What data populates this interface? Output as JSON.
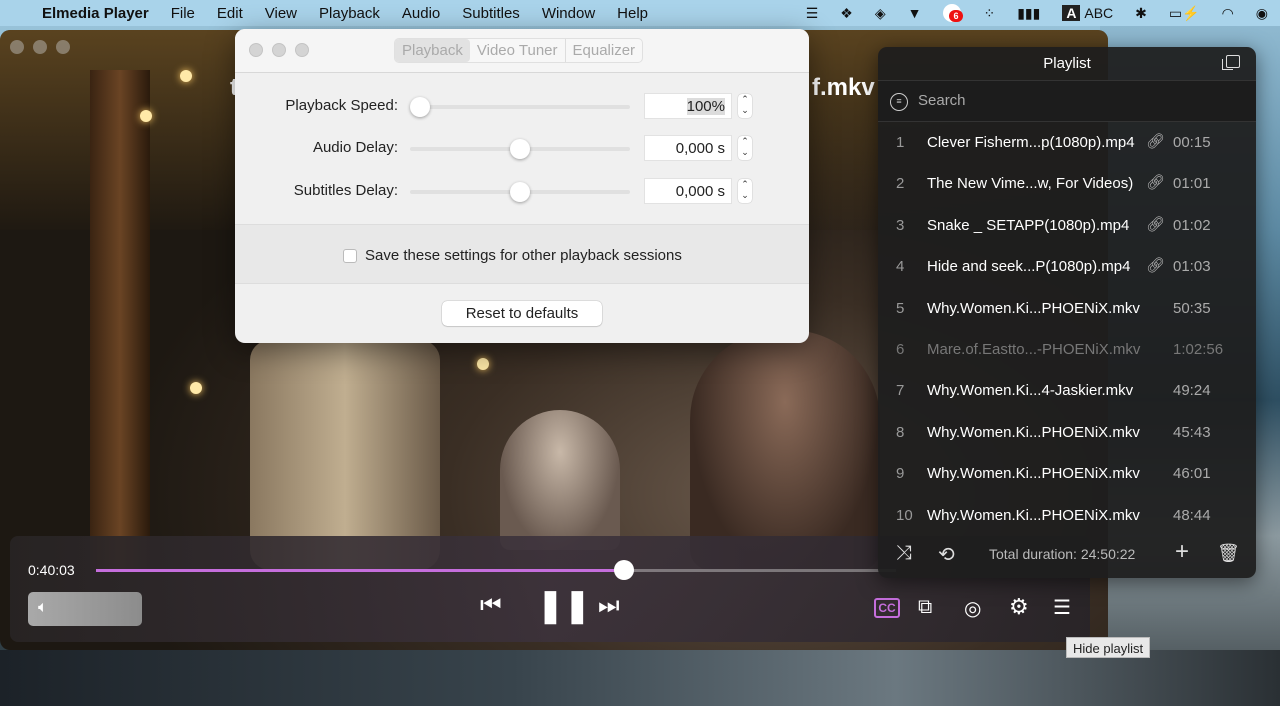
{
  "menubar": {
    "app": "Elmedia Player",
    "items": [
      "File",
      "Edit",
      "View",
      "Playback",
      "Audio",
      "Subtitles",
      "Window",
      "Help"
    ],
    "notification_count": "6",
    "input_source": "ABC"
  },
  "player": {
    "title_fragment_left": "t",
    "title_fragment_right": "f.mkv",
    "elapsed": "0:40:03",
    "progress": 0.66
  },
  "dialog": {
    "tabs": [
      "Playback",
      "Video Tuner",
      "Equalizer"
    ],
    "active_tab": "Playback",
    "rows": [
      {
        "label": "Playback Speed:",
        "value": "100%",
        "slider": 0.0
      },
      {
        "label": "Audio Delay:",
        "value": "0,000 s",
        "slider": 0.5
      },
      {
        "label": "Subtitles Delay:",
        "value": "0,000 s",
        "slider": 0.5
      }
    ],
    "save_label": "Save these settings for other playback sessions",
    "save_checked": false,
    "reset_label": "Reset to defaults"
  },
  "playlist": {
    "title": "Playlist",
    "search_placeholder": "Search",
    "items": [
      {
        "n": "1",
        "title": "Clever Fisherm...p(1080p).mp4",
        "link": true,
        "duration": "00:15"
      },
      {
        "n": "2",
        "title": "The New Vime...w, For Videos)",
        "link": true,
        "duration": "01:01"
      },
      {
        "n": "3",
        "title": "Snake _ SETAPP(1080p).mp4",
        "link": true,
        "duration": "01:02"
      },
      {
        "n": "4",
        "title": "Hide and seek...P(1080p).mp4",
        "link": true,
        "duration": "01:03"
      },
      {
        "n": "5",
        "title": "Why.Women.Ki...PHOENiX.mkv",
        "link": false,
        "duration": "50:35"
      },
      {
        "n": "6",
        "title": "Mare.of.Eastto...-PHOENiX.mkv",
        "link": false,
        "duration": "1:02:56",
        "dimmed": true
      },
      {
        "n": "7",
        "title": "Why.Women.Ki...4-Jaskier.mkv",
        "link": false,
        "duration": "49:24"
      },
      {
        "n": "8",
        "title": "Why.Women.Ki...PHOENiX.mkv",
        "link": false,
        "duration": "45:43"
      },
      {
        "n": "9",
        "title": "Why.Women.Ki...PHOENiX.mkv",
        "link": false,
        "duration": "46:01"
      },
      {
        "n": "10",
        "title": "Why.Women.Ki...PHOENiX.mkv",
        "link": false,
        "duration": "48:44"
      }
    ],
    "total": "Total duration: 24:50:22"
  },
  "controls": {
    "cc_label": "CC"
  },
  "tooltip": "Hide playlist",
  "colors": {
    "accent": "#c56edc"
  }
}
